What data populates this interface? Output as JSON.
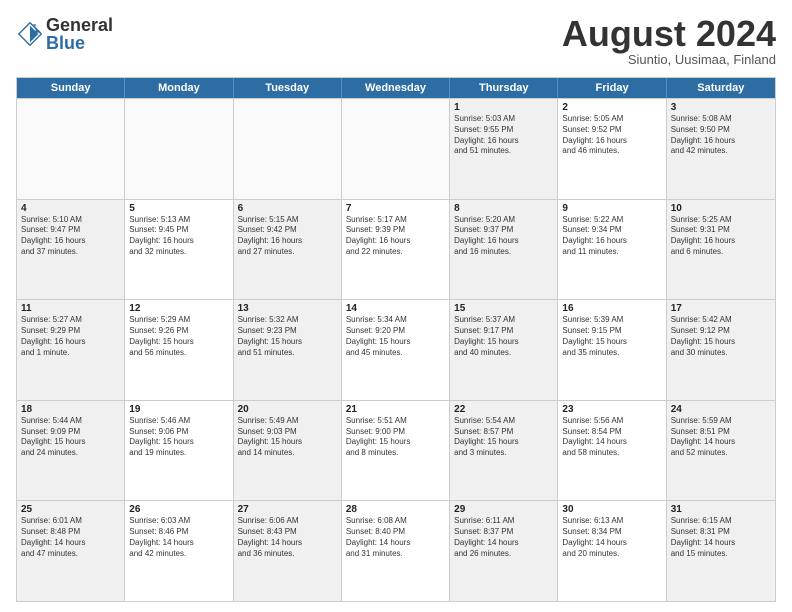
{
  "logo": {
    "general": "General",
    "blue": "Blue"
  },
  "title": "August 2024",
  "subtitle": "Siuntio, Uusimaa, Finland",
  "header_days": [
    "Sunday",
    "Monday",
    "Tuesday",
    "Wednesday",
    "Thursday",
    "Friday",
    "Saturday"
  ],
  "rows": [
    [
      {
        "num": "",
        "info": "",
        "empty": true
      },
      {
        "num": "",
        "info": "",
        "empty": true
      },
      {
        "num": "",
        "info": "",
        "empty": true
      },
      {
        "num": "",
        "info": "",
        "empty": true
      },
      {
        "num": "1",
        "info": "Sunrise: 5:03 AM\nSunset: 9:55 PM\nDaylight: 16 hours\nand 51 minutes.",
        "empty": false
      },
      {
        "num": "2",
        "info": "Sunrise: 5:05 AM\nSunset: 9:52 PM\nDaylight: 16 hours\nand 46 minutes.",
        "empty": false
      },
      {
        "num": "3",
        "info": "Sunrise: 5:08 AM\nSunset: 9:50 PM\nDaylight: 16 hours\nand 42 minutes.",
        "empty": false
      }
    ],
    [
      {
        "num": "4",
        "info": "Sunrise: 5:10 AM\nSunset: 9:47 PM\nDaylight: 16 hours\nand 37 minutes.",
        "empty": false
      },
      {
        "num": "5",
        "info": "Sunrise: 5:13 AM\nSunset: 9:45 PM\nDaylight: 16 hours\nand 32 minutes.",
        "empty": false
      },
      {
        "num": "6",
        "info": "Sunrise: 5:15 AM\nSunset: 9:42 PM\nDaylight: 16 hours\nand 27 minutes.",
        "empty": false
      },
      {
        "num": "7",
        "info": "Sunrise: 5:17 AM\nSunset: 9:39 PM\nDaylight: 16 hours\nand 22 minutes.",
        "empty": false
      },
      {
        "num": "8",
        "info": "Sunrise: 5:20 AM\nSunset: 9:37 PM\nDaylight: 16 hours\nand 16 minutes.",
        "empty": false
      },
      {
        "num": "9",
        "info": "Sunrise: 5:22 AM\nSunset: 9:34 PM\nDaylight: 16 hours\nand 11 minutes.",
        "empty": false
      },
      {
        "num": "10",
        "info": "Sunrise: 5:25 AM\nSunset: 9:31 PM\nDaylight: 16 hours\nand 6 minutes.",
        "empty": false
      }
    ],
    [
      {
        "num": "11",
        "info": "Sunrise: 5:27 AM\nSunset: 9:29 PM\nDaylight: 16 hours\nand 1 minute.",
        "empty": false
      },
      {
        "num": "12",
        "info": "Sunrise: 5:29 AM\nSunset: 9:26 PM\nDaylight: 15 hours\nand 56 minutes.",
        "empty": false
      },
      {
        "num": "13",
        "info": "Sunrise: 5:32 AM\nSunset: 9:23 PM\nDaylight: 15 hours\nand 51 minutes.",
        "empty": false
      },
      {
        "num": "14",
        "info": "Sunrise: 5:34 AM\nSunset: 9:20 PM\nDaylight: 15 hours\nand 45 minutes.",
        "empty": false
      },
      {
        "num": "15",
        "info": "Sunrise: 5:37 AM\nSunset: 9:17 PM\nDaylight: 15 hours\nand 40 minutes.",
        "empty": false
      },
      {
        "num": "16",
        "info": "Sunrise: 5:39 AM\nSunset: 9:15 PM\nDaylight: 15 hours\nand 35 minutes.",
        "empty": false
      },
      {
        "num": "17",
        "info": "Sunrise: 5:42 AM\nSunset: 9:12 PM\nDaylight: 15 hours\nand 30 minutes.",
        "empty": false
      }
    ],
    [
      {
        "num": "18",
        "info": "Sunrise: 5:44 AM\nSunset: 9:09 PM\nDaylight: 15 hours\nand 24 minutes.",
        "empty": false
      },
      {
        "num": "19",
        "info": "Sunrise: 5:46 AM\nSunset: 9:06 PM\nDaylight: 15 hours\nand 19 minutes.",
        "empty": false
      },
      {
        "num": "20",
        "info": "Sunrise: 5:49 AM\nSunset: 9:03 PM\nDaylight: 15 hours\nand 14 minutes.",
        "empty": false
      },
      {
        "num": "21",
        "info": "Sunrise: 5:51 AM\nSunset: 9:00 PM\nDaylight: 15 hours\nand 8 minutes.",
        "empty": false
      },
      {
        "num": "22",
        "info": "Sunrise: 5:54 AM\nSunset: 8:57 PM\nDaylight: 15 hours\nand 3 minutes.",
        "empty": false
      },
      {
        "num": "23",
        "info": "Sunrise: 5:56 AM\nSunset: 8:54 PM\nDaylight: 14 hours\nand 58 minutes.",
        "empty": false
      },
      {
        "num": "24",
        "info": "Sunrise: 5:59 AM\nSunset: 8:51 PM\nDaylight: 14 hours\nand 52 minutes.",
        "empty": false
      }
    ],
    [
      {
        "num": "25",
        "info": "Sunrise: 6:01 AM\nSunset: 8:48 PM\nDaylight: 14 hours\nand 47 minutes.",
        "empty": false
      },
      {
        "num": "26",
        "info": "Sunrise: 6:03 AM\nSunset: 8:46 PM\nDaylight: 14 hours\nand 42 minutes.",
        "empty": false
      },
      {
        "num": "27",
        "info": "Sunrise: 6:06 AM\nSunset: 8:43 PM\nDaylight: 14 hours\nand 36 minutes.",
        "empty": false
      },
      {
        "num": "28",
        "info": "Sunrise: 6:08 AM\nSunset: 8:40 PM\nDaylight: 14 hours\nand 31 minutes.",
        "empty": false
      },
      {
        "num": "29",
        "info": "Sunrise: 6:11 AM\nSunset: 8:37 PM\nDaylight: 14 hours\nand 26 minutes.",
        "empty": false
      },
      {
        "num": "30",
        "info": "Sunrise: 6:13 AM\nSunset: 8:34 PM\nDaylight: 14 hours\nand 20 minutes.",
        "empty": false
      },
      {
        "num": "31",
        "info": "Sunrise: 6:15 AM\nSunset: 8:31 PM\nDaylight: 14 hours\nand 15 minutes.",
        "empty": false
      }
    ]
  ]
}
